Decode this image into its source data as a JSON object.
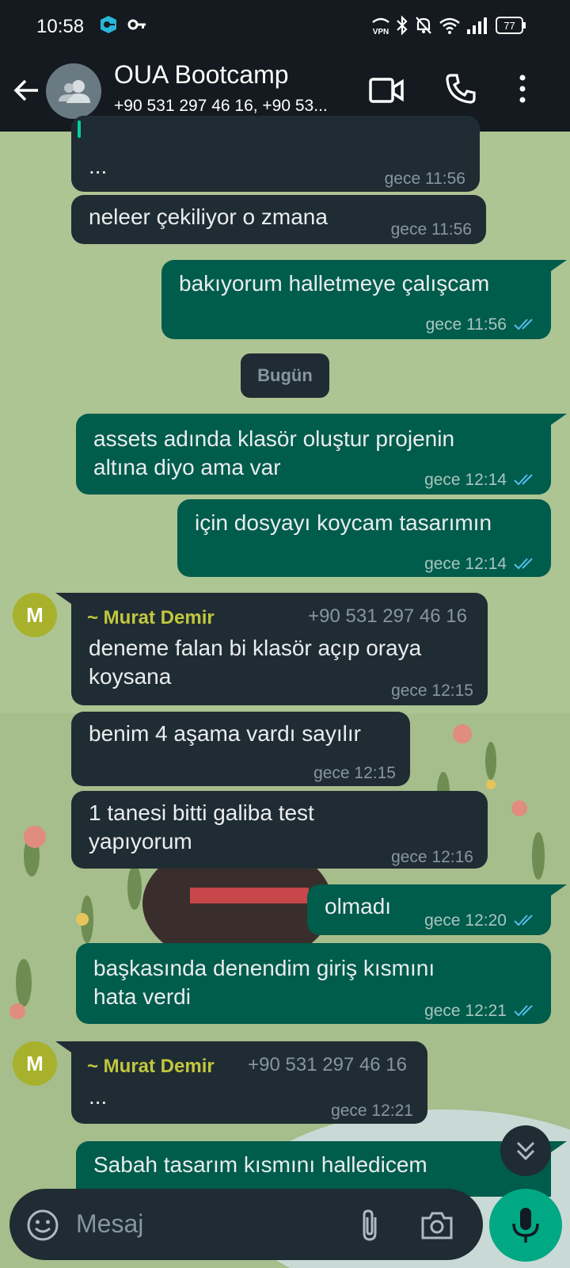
{
  "status_bar": {
    "time": "10:58",
    "battery": "77",
    "icons": [
      "vpn-app-icon",
      "key-icon",
      "vpn-icon",
      "bluetooth-icon",
      "mute-icon",
      "wifi-icon",
      "signal-icon",
      "battery-icon"
    ]
  },
  "header": {
    "title": "OUA Bootcamp",
    "subtitle": "+90 531 297 46 16, +90 53...",
    "icons": [
      "back-arrow-icon",
      "group-avatar-icon",
      "video-call-icon",
      "voice-call-icon",
      "more-options-icon"
    ]
  },
  "messages": [
    {
      "id": "m0",
      "dir": "in",
      "text": [
        "..."
      ],
      "time": "gece 11:56"
    },
    {
      "id": "m1",
      "dir": "in",
      "text": [
        "neleer çekiliyor o zmana"
      ],
      "time": "gece 11:56"
    },
    {
      "id": "m2",
      "dir": "out",
      "text": [
        "bakıyorum halletmeye çalışcam"
      ],
      "time": "gece 11:56",
      "read": true
    },
    {
      "id": "m3",
      "dir": "out",
      "text": [
        "assets adında klasör oluştur projenin",
        "altına diyo ama var"
      ],
      "time": "gece 12:14",
      "read": true
    },
    {
      "id": "m4",
      "dir": "out",
      "text": [
        "için dosyayı koycam tasarımın"
      ],
      "time": "gece 12:14",
      "read": true
    },
    {
      "id": "m5",
      "dir": "in",
      "sender": "~ Murat Demir",
      "phone": "+90 531 297 46 16",
      "avatar": "M",
      "text": [
        "deneme falan bi klasör açıp oraya",
        "koysana"
      ],
      "time": "gece 12:15"
    },
    {
      "id": "m6",
      "dir": "in",
      "text": [
        "benim 4 aşama vardı sayılır"
      ],
      "time": "gece 12:15"
    },
    {
      "id": "m7",
      "dir": "in",
      "text": [
        "1 tanesi bitti galiba test",
        "yapıyorum"
      ],
      "time": "gece 12:16"
    },
    {
      "id": "m8",
      "dir": "out",
      "text": [
        "olmadı"
      ],
      "time": "gece 12:20",
      "read": true
    },
    {
      "id": "m9",
      "dir": "out",
      "text": [
        "başkasında denendim giriş kısmını",
        "hata verdi"
      ],
      "time": "gece 12:21",
      "read": true
    },
    {
      "id": "m10",
      "dir": "in",
      "sender": "~ Murat Demir",
      "phone": "+90 531 297 46 16",
      "avatar": "M",
      "text": [
        "..."
      ],
      "time": "gece 12:21"
    },
    {
      "id": "m11",
      "dir": "out",
      "text": [
        "Sabah tasarım kısmını halledicem"
      ],
      "time": ""
    }
  ],
  "day_separator": "Bugün",
  "composer": {
    "placeholder": "Mesaj",
    "icons": [
      "emoji-icon",
      "attach-icon",
      "camera-icon",
      "mic-icon"
    ]
  },
  "colors": {
    "header_bg": "#141a1f",
    "incoming_bubble": "#202c33",
    "outgoing_bubble": "#005c4b",
    "sender_name": "#c2c73e",
    "read_tick": "#53bdeb",
    "mic_button": "#00a884"
  }
}
